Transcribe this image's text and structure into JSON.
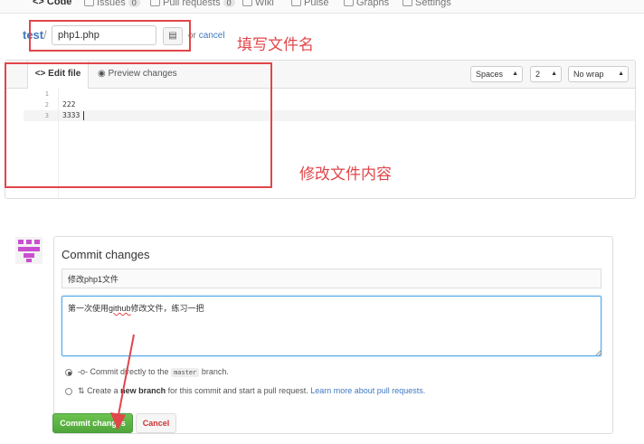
{
  "nav": {
    "code": "Code",
    "issues": "Issues",
    "issues_count": "0",
    "pulls": "Pull requests",
    "pulls_count": "0",
    "wiki": "Wiki",
    "pulse": "Pulse",
    "graphs": "Graphs",
    "settings": "Settings"
  },
  "path": {
    "repo": "test",
    "separator": "/",
    "filename": "php1.php",
    "or": "or",
    "cancel": "cancel"
  },
  "editor": {
    "edit_tab": "Edit file",
    "preview_tab": "Preview changes",
    "indent_mode": "Spaces",
    "indent_size": "2",
    "wrap_mode": "No wrap",
    "lines": [
      {
        "num": "1",
        "text": ""
      },
      {
        "num": "2",
        "text": "222"
      },
      {
        "num": "3",
        "text": "3333"
      }
    ]
  },
  "annotations": {
    "filename_note": "填写文件名",
    "content_note": "修改文件内容",
    "color": "#e0464a"
  },
  "commit": {
    "title": "Commit changes",
    "summary_value": "修改php1文件",
    "description_before": "第一次使用",
    "description_squiggle": "github",
    "description_after": "修改文件，练习一把",
    "option1_before": "Commit directly to the",
    "option1_branch": "master",
    "option1_after": "branch.",
    "option2_before": "Create a",
    "option2_bold": "new branch",
    "option2_after": "for this commit and start a pull request.",
    "option2_link": "Learn more about pull requests.",
    "commit_button": "Commit changes",
    "cancel_button": "Cancel"
  },
  "colors": {
    "link": "#4078c0",
    "commit_button": "#55a83f",
    "focus": "#51a7e8"
  }
}
